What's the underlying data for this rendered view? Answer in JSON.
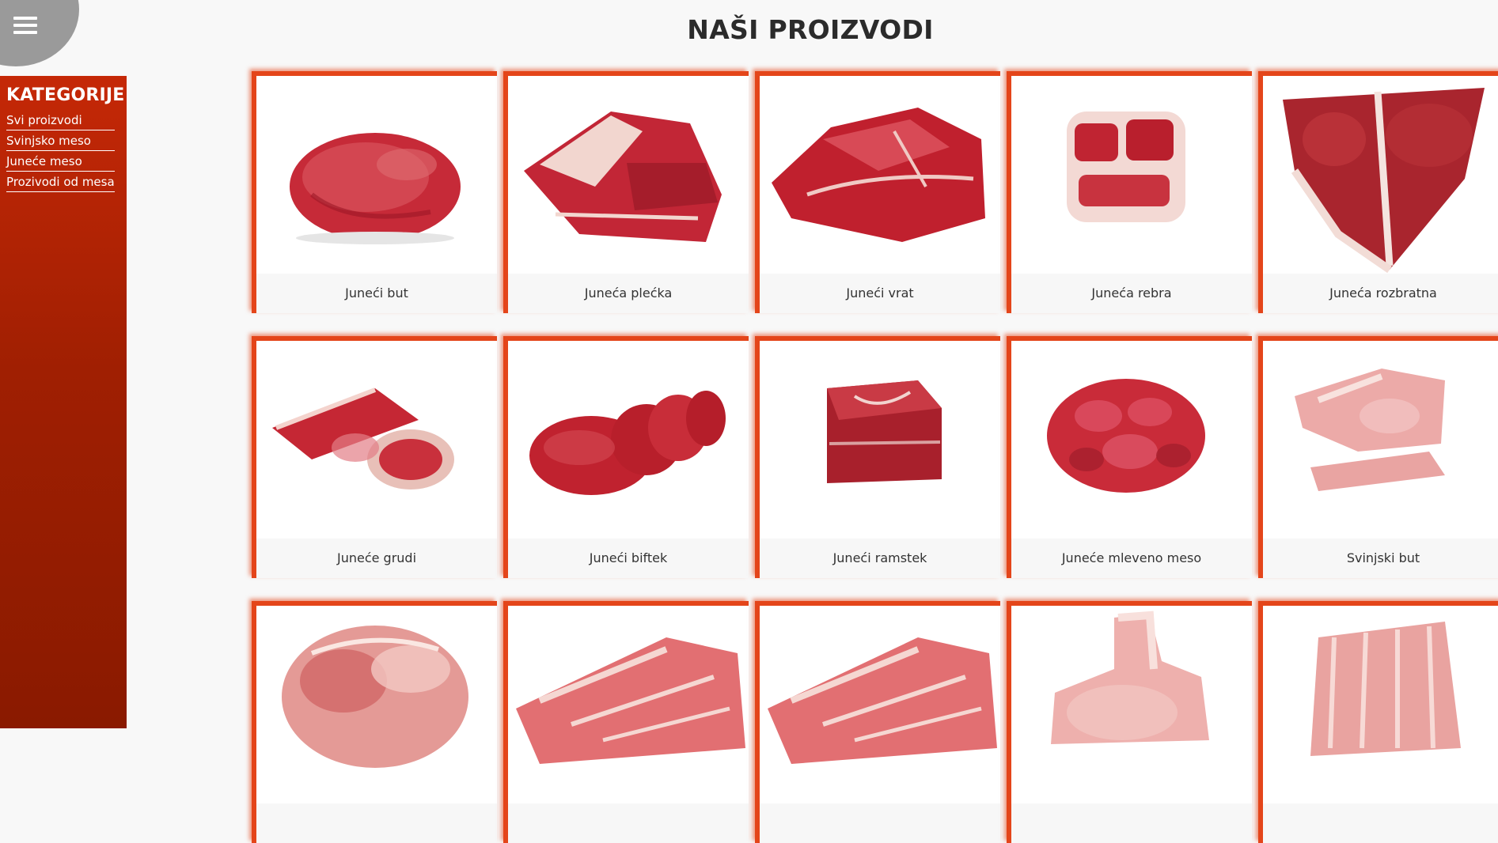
{
  "header": {
    "title": "NAŠI PROIZVODI",
    "menu_icon": "hamburger-icon"
  },
  "sidebar": {
    "title": "KATEGORIJE",
    "items": [
      "Svi proizvodi",
      "Svinjsko meso",
      "Juneće meso",
      "Prozivodi od mesa"
    ]
  },
  "products": [
    {
      "name": "Juneći but",
      "image": "beef-round-roast"
    },
    {
      "name": "Juneća plećka",
      "image": "beef-shoulder-cut"
    },
    {
      "name": "Juneći vrat",
      "image": "beef-neck-cut"
    },
    {
      "name": "Juneća rebra",
      "image": "beef-ribs-cut"
    },
    {
      "name": "Juneća rozbratna",
      "image": "beef-tbone-steak"
    },
    {
      "name": "Juneće grudi",
      "image": "beef-brisket-slices"
    },
    {
      "name": "Juneći biftek",
      "image": "beef-tenderloin-sliced"
    },
    {
      "name": "Juneći ramstek",
      "image": "beef-rumpsteak-block"
    },
    {
      "name": "Juneće mleveno meso",
      "image": "beef-minced-meat"
    },
    {
      "name": "Svinjski but",
      "image": "pork-leg-cut"
    },
    {
      "name": "",
      "image": "pork-shoulder-roast"
    },
    {
      "name": "",
      "image": "pork-neck-marbled"
    },
    {
      "name": "",
      "image": "pork-neck-marbled"
    },
    {
      "name": "",
      "image": "pork-chop-bone"
    },
    {
      "name": "",
      "image": "pork-ribs-slab"
    }
  ],
  "colors": {
    "accent": "#e4451a",
    "sidebar_top": "#c52807",
    "sidebar_bottom": "#8a1a00",
    "beef": "#b8202c",
    "pork": "#e79a98"
  }
}
